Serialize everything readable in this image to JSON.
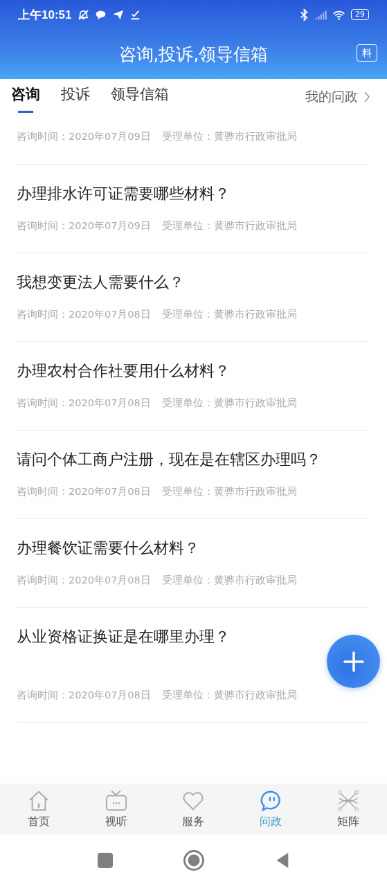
{
  "status_bar": {
    "time": "上午10:51",
    "battery": "29"
  },
  "header": {
    "title": "咨询,投诉,领导信箱",
    "icon_text": "料"
  },
  "tabs": [
    {
      "label": "咨询",
      "selected": true
    },
    {
      "label": "投诉",
      "selected": false
    },
    {
      "label": "领导信箱",
      "selected": false
    }
  ],
  "my_link": "我的问政",
  "items": [
    {
      "kind": "partial",
      "time": "咨询时间：2020年07月09日",
      "unit": "受理单位：黄骅市行政审批局"
    },
    {
      "kind": "normal",
      "title": "办理排水许可证需要哪些材料？",
      "time": "咨询时间：2020年07月09日",
      "unit": "受理单位：黄骅市行政审批局"
    },
    {
      "kind": "normal",
      "title": "我想变更法人需要什么？",
      "time": "咨询时间：2020年07月08日",
      "unit": "受理单位：黄骅市行政审批局"
    },
    {
      "kind": "normal",
      "title": "办理农村合作社要用什么材料？",
      "time": "咨询时间：2020年07月08日",
      "unit": "受理单位：黄骅市行政审批局"
    },
    {
      "kind": "normal",
      "title": "请问个体工商户注册，现在是在辖区办理吗？",
      "time": "咨询时间：2020年07月08日",
      "unit": "受理单位：黄骅市行政审批局"
    },
    {
      "kind": "normal",
      "title": "办理餐饮证需要什么材料？",
      "time": "咨询时间：2020年07月08日",
      "unit": "受理单位：黄骅市行政审批局"
    },
    {
      "kind": "tall",
      "title": "从业资格证换证是在哪里办理？",
      "time": "咨询时间：2020年07月08日",
      "unit": "受理单位：黄骅市行政审批局"
    }
  ],
  "bottom_nav": [
    {
      "kind": "home",
      "label": "首页",
      "selected": false
    },
    {
      "kind": "tv",
      "label": "视听",
      "selected": false
    },
    {
      "kind": "heart",
      "label": "服务",
      "selected": false
    },
    {
      "kind": "chat",
      "label": "问政",
      "selected": true
    },
    {
      "kind": "matrix",
      "label": "矩阵",
      "selected": false
    }
  ]
}
